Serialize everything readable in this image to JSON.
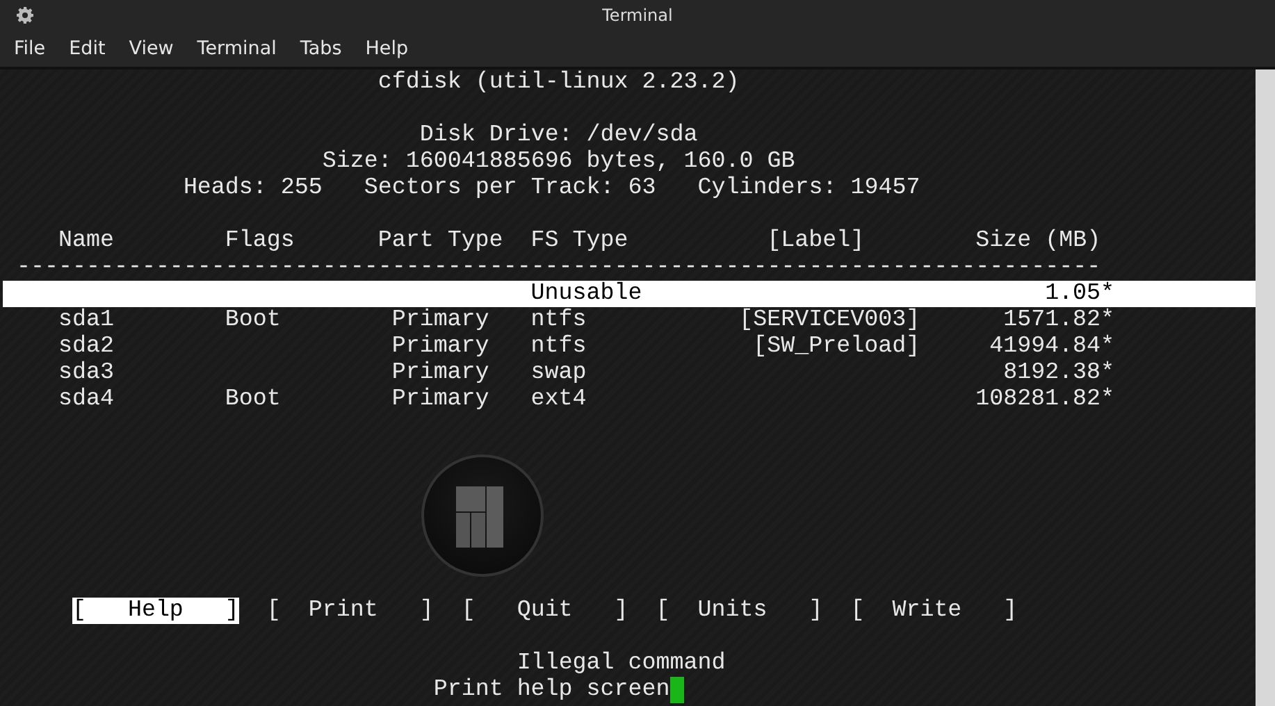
{
  "window": {
    "title": "Terminal"
  },
  "menu": [
    "File",
    "Edit",
    "View",
    "Terminal",
    "Tabs",
    "Help"
  ],
  "terminal": {
    "header": [
      "cfdisk (util-linux 2.23.2)",
      "Disk Drive: /dev/sda",
      "Size: 160041885696 bytes, 160.0 GB",
      "Heads: 255   Sectors per Track: 63   Cylinders: 19457"
    ],
    "columns": [
      "Name",
      "Flags",
      "Part Type",
      "FS Type",
      "[Label]",
      "Size (MB)"
    ],
    "separator": "------------------------------------------------------------------------------",
    "partitions": [
      {
        "fs_type": "Unusable",
        "size": "1.05*",
        "selected": true
      },
      {
        "name": "sda1",
        "flags": "Boot",
        "part_type": "Primary",
        "fs_type": "ntfs",
        "label": "[SERVICEV003]",
        "size": "1571.82*",
        "selected": false
      },
      {
        "name": "sda2",
        "part_type": "Primary",
        "fs_type": "ntfs",
        "label": "[SW_Preload]",
        "size": "41994.84*",
        "selected": false
      },
      {
        "name": "sda3",
        "part_type": "Primary",
        "fs_type": "swap",
        "size": "8192.38*",
        "selected": false
      },
      {
        "name": "sda4",
        "flags": "Boot",
        "part_type": "Primary",
        "fs_type": "ext4",
        "size": "108281.82*",
        "selected": false
      }
    ],
    "actions": [
      {
        "label": "[   Help   ]",
        "selected": true
      },
      {
        "label": "[  Print   ]",
        "selected": false
      },
      {
        "label": "[   Quit   ]",
        "selected": false
      },
      {
        "label": "[  Units   ]",
        "selected": false
      },
      {
        "label": "[  Write   ]",
        "selected": false
      }
    ],
    "message": "Illegal command",
    "prompt": "Print help screen"
  }
}
